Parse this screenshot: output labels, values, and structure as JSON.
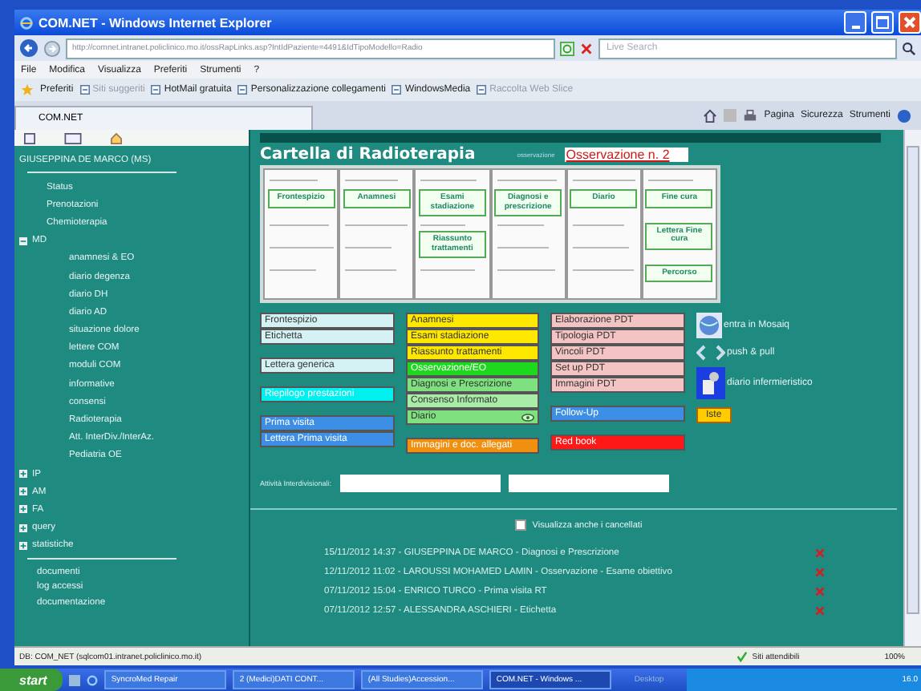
{
  "window": {
    "title": "COM.NET - Windows Internet Explorer"
  },
  "address_bar": {
    "url": "http://comnet.intranet.policlinico.mo.it/ossRapLinks.asp?IntIdPaziente=4491&IdTipoModello=Radio",
    "search_placeholder": "Live Search"
  },
  "menu": [
    "File",
    "Modifica",
    "Visualizza",
    "Preferiti",
    "Strumenti",
    "?"
  ],
  "favorites_bar": {
    "label": "Preferiti",
    "links": [
      "Siti suggeriti",
      "HotMail gratuita",
      "Personalizzazione collegamenti",
      "WindowsMedia",
      "Raccolta Web Slice"
    ]
  },
  "tab": {
    "title": "COM.NET"
  },
  "command_bar": [
    "Pagina",
    "Sicurezza",
    "Strumenti"
  ],
  "sidebar": {
    "patient": "GIUSEPPINA DE MARCO (MS)",
    "items": [
      {
        "label": "Status"
      },
      {
        "label": "Prenotazioni"
      },
      {
        "label": "Chemioterapia"
      },
      {
        "label": "MD",
        "expanded": true,
        "children": [
          {
            "label": "anamnesi & EO"
          },
          {
            "label": "diario degenza"
          },
          {
            "label": "diario DH"
          },
          {
            "label": "diario AD"
          },
          {
            "label": "situazione dolore"
          },
          {
            "label": "lettere COM"
          },
          {
            "label": "moduli COM"
          },
          {
            "label": "informative"
          },
          {
            "label": "consensi"
          },
          {
            "label": "Radioterapia"
          },
          {
            "label": "Att. InterDiv./InterAz."
          },
          {
            "label": "Pediatria OE"
          }
        ]
      },
      {
        "label": "IP",
        "expanded": false
      },
      {
        "label": "AM",
        "expanded": false
      },
      {
        "label": "FA",
        "expanded": false
      },
      {
        "label": "query",
        "expanded": false
      },
      {
        "label": "statistiche",
        "expanded": false
      }
    ],
    "links": [
      "documenti",
      "log accessi",
      "documentazione"
    ]
  },
  "main": {
    "title": "Cartella di Radioterapia",
    "observation_label": "osservazione",
    "observation_value": "Osservazione n. 2",
    "pages": [
      {
        "buttons": [
          "Frontespizio"
        ]
      },
      {
        "buttons": [
          "Anamnesi"
        ]
      },
      {
        "buttons": [
          "Esami stadiazione",
          "Riassunto trattamenti"
        ]
      },
      {
        "buttons": [
          "Diagnosi e prescrizione"
        ]
      },
      {
        "buttons": [
          "Diario"
        ]
      },
      {
        "buttons": [
          "Fine cura",
          "Lettera Fine cura",
          "Percorso"
        ]
      }
    ],
    "button_columns": [
      [
        [
          {
            "label": "Frontespizio",
            "color": "#d4f2f4"
          },
          {
            "label": "Etichetta",
            "color": "#d4f2f4"
          }
        ],
        [
          {
            "label": "Lettera generica",
            "color": "#d4f2f4"
          }
        ],
        [
          {
            "label": "Riepilogo prestazioni",
            "color": "#00f0f0"
          }
        ],
        [
          {
            "label": "Prima visita",
            "color": "#3d8fe6"
          },
          {
            "label": "Lettera Prima visita",
            "color": "#3d8fe6"
          }
        ]
      ],
      [
        [
          {
            "label": "Anamnesi",
            "color": "#ffe800"
          },
          {
            "label": "Esami stadiazione",
            "color": "#ffe800"
          },
          {
            "label": "Riassunto trattamenti",
            "color": "#ffe800"
          },
          {
            "label": "Osservazione/EO",
            "color": "#1ed81e"
          },
          {
            "label": "Diagnosi e Prescrizione",
            "color": "#7ee07e"
          },
          {
            "label": "Consenso Informato",
            "color": "#a8eca8"
          },
          {
            "label": "Diario",
            "color": "#7ee07e",
            "icon": true
          }
        ],
        [
          {
            "label": "Immagini e doc. allegati",
            "color": "#f09010"
          }
        ]
      ],
      [
        [
          {
            "label": "Elaborazione PDT",
            "color": "#f4c4c4"
          },
          {
            "label": "Tipologia PDT",
            "color": "#f4c4c4"
          },
          {
            "label": "Vincoli PDT",
            "color": "#f4c4c4"
          },
          {
            "label": "Set up PDT",
            "color": "#f4c4c4"
          },
          {
            "label": "Immagini PDT",
            "color": "#f4c4c4"
          }
        ],
        [
          {
            "label": "Follow-Up",
            "color": "#3d8fe6"
          }
        ],
        [
          {
            "label": "Red book",
            "color": "#ff1818"
          }
        ]
      ]
    ],
    "tools": [
      {
        "kind": "mosaiq",
        "label": "entra in Mosaiq"
      },
      {
        "kind": "sync",
        "label": "push & pull"
      },
      {
        "kind": "nurse",
        "label": "diario infermieristico"
      },
      {
        "kind": "button",
        "label": "Iste"
      }
    ],
    "interdivisional_label": "Attività Interdivisionali:",
    "show_deleted": {
      "label": "Visualizza anche i cancellati",
      "checked": false
    },
    "log": [
      "15/11/2012 14:37 - GIUSEPPINA DE MARCO - Diagnosi e Prescrizione",
      "12/11/2012 11:02 - LAROUSSI MOHAMED LAMIN - Osservazione - Esame obiettivo",
      "07/11/2012 15:04 - ENRICO TURCO - Prima visita RT",
      "07/11/2012 12:57 - ALESSANDRA ASCHIERI - Etichetta"
    ]
  },
  "status_bar": {
    "text": "DB: COM_NET (sqlcom01.intranet.policlinico.mo.it)",
    "zone": "Siti attendibili",
    "zoom": "100%"
  },
  "taskbar": {
    "start": "start",
    "tasks": [
      "SyncroMed Repair",
      "2 (Medici)DATI CONT...",
      "(All Studies)Accession...",
      "COM.NET - Windows ..."
    ],
    "desktop": "Desktop",
    "clock": "16.0"
  }
}
